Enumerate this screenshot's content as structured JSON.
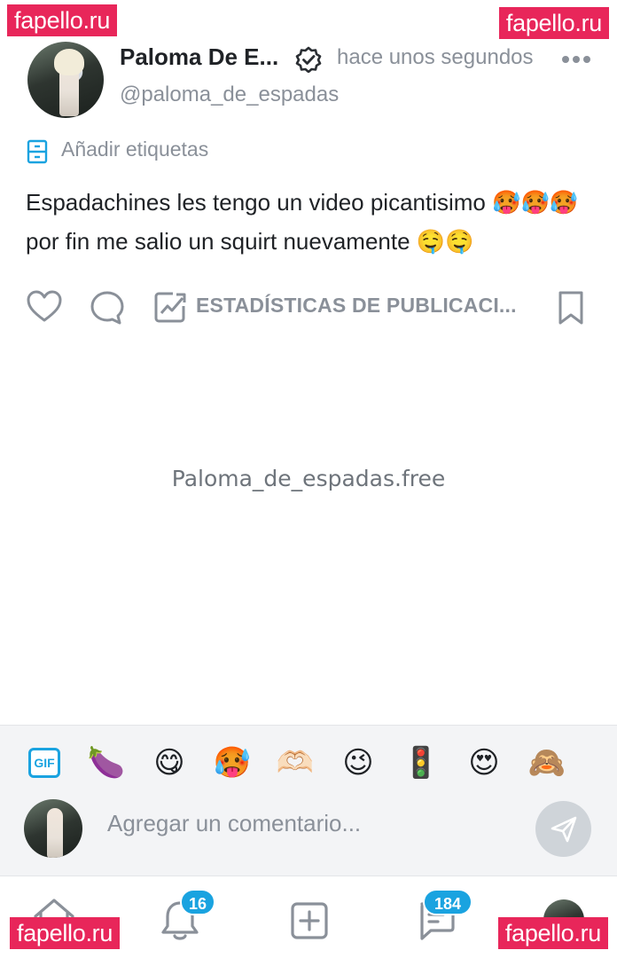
{
  "watermarks": {
    "top_left": "fapello.ru",
    "top_right": "fapello.ru",
    "bottom_left": "fapello.ru",
    "bottom_right": "fapello.ru"
  },
  "post": {
    "author_name": "Paloma De E...",
    "verified_icon": "verified-badge-icon",
    "time": "hace unos segundos",
    "handle": "@paloma_de_espadas",
    "add_tags_label": "Añadir etiquetas",
    "text": "Espadachines les tengo un video picantisimo 🥵🥵🥵 por fin me salio un squirt nuevamente 🤤🤤",
    "stats_label": "ESTADÍSTICAS DE PUBLICACI...",
    "media_caption": "Paloma_de_espadas.free"
  },
  "quick_emojis": [
    "🍆",
    "😋",
    "🥵",
    "🫶🏻",
    "😉",
    "🚦",
    "😍",
    "🙈"
  ],
  "gif_label": "GIF",
  "comment": {
    "placeholder": "Agregar un comentario..."
  },
  "nav": {
    "notifications_count": "16",
    "messages_count": "184"
  },
  "colors": {
    "accent": "#1aa3e0",
    "watermark": "#e8265a",
    "muted": "#8a9099"
  }
}
